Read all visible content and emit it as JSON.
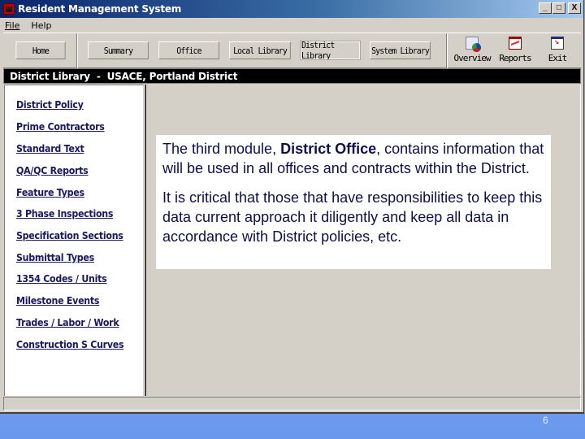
{
  "window": {
    "title": "Resident Management System",
    "buttons": {
      "minimize": "_",
      "maximize": "□",
      "close": "X"
    }
  },
  "menu": {
    "items": [
      {
        "label": "File",
        "accel": "F"
      },
      {
        "label": "Help",
        "accel": "H"
      }
    ]
  },
  "toolbar": {
    "buttons": [
      {
        "id": "home",
        "label": "Home"
      },
      {
        "id": "summary",
        "label": "Summary"
      },
      {
        "id": "office",
        "label": "Office"
      },
      {
        "id": "local-library",
        "label": "Local Library"
      },
      {
        "id": "district-library",
        "label": "District Library",
        "active": true
      },
      {
        "id": "system-library",
        "label": "System Library"
      }
    ],
    "icon_buttons": [
      {
        "id": "overview",
        "label": "Overview",
        "icon": "overview-icon"
      },
      {
        "id": "reports",
        "label": "Reports",
        "icon": "reports-icon"
      },
      {
        "id": "exit",
        "label": "Exit",
        "icon": "exit-icon"
      }
    ]
  },
  "header": {
    "title": "District Library  -  USACE, Portland District"
  },
  "sidebar": {
    "links": [
      "District Policy",
      "Prime Contractors",
      "Standard Text",
      "QA/QC Reports",
      "Feature Types",
      "3 Phase Inspections",
      "Specification Sections",
      "Submittal Types",
      "1354 Codes / Units",
      "Milestone Events",
      "Trades / Labor / Work",
      "Construction S Curves"
    ]
  },
  "callout": {
    "p1_before": "The third module, ",
    "p1_bold": "District Office",
    "p1_after": ", contains information that will be used in all offices and contracts within the District.",
    "p2": "It is critical that those that have responsibilities to keep this data current approach it diligently and keep all data in accordance with District policies, etc."
  },
  "slide": {
    "page_number": "6"
  }
}
